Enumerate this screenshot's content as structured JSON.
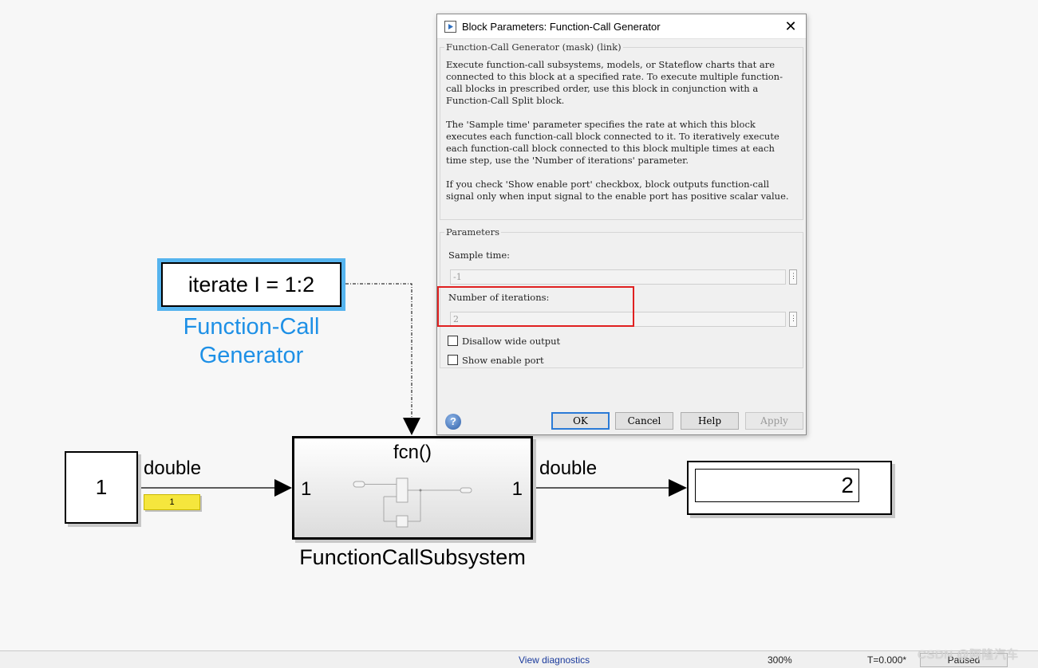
{
  "model": {
    "constant_value": "1",
    "generator": {
      "text": "iterate I = 1:2",
      "name_line1": "Function-Call",
      "name_line2": "Generator"
    },
    "subsystem": {
      "trigger_label": "fcn()",
      "in_port": "1",
      "out_port": "1",
      "name": "FunctionCallSubsystem"
    },
    "display_value": "2",
    "signal_in_type": "double",
    "signal_out_type": "double",
    "value_badge": "1",
    "colors": {
      "generator_highlight": "#56b4ee",
      "generator_name": "#1e90e6",
      "value_badge": "#f5e63d"
    }
  },
  "dialog": {
    "title": "Block Parameters: Function-Call Generator",
    "close_glyph": "✕",
    "description_legend": "Function-Call Generator (mask) (link)",
    "description": [
      "Execute function-call subsystems, models, or Stateflow charts that are connected to this block at a specified rate. To execute multiple function-call blocks in prescribed order, use this block in conjunction with a Function-Call Split block.",
      "The 'Sample time' parameter specifies the rate at which this block executes each function-call block connected to it. To iteratively execute each function-call block connected to this block multiple times at each time step,  use the 'Number of iterations' parameter.",
      "If you check 'Show enable port' checkbox, block outputs function-call signal only when input signal to the enable port has positive scalar value."
    ],
    "parameters_legend": "Parameters",
    "sample_time_label": "Sample time:",
    "sample_time_value": "-1",
    "iterations_label": "Number of iterations:",
    "iterations_value": "2",
    "disallow_wide_label": "Disallow wide output",
    "disallow_wide_checked": false,
    "show_enable_label": "Show enable port",
    "show_enable_checked": false,
    "menu_glyph": "⋮",
    "help_glyph": "?",
    "buttons": {
      "ok": "OK",
      "cancel": "Cancel",
      "help": "Help",
      "apply": "Apply"
    },
    "highlight_color": "#e02020"
  },
  "status": {
    "diagnostics": "View diagnostics",
    "zoom": "300%",
    "time": "T=0.000*",
    "state": "Paused"
  },
  "watermark": "CSDN @阿隆汽车"
}
